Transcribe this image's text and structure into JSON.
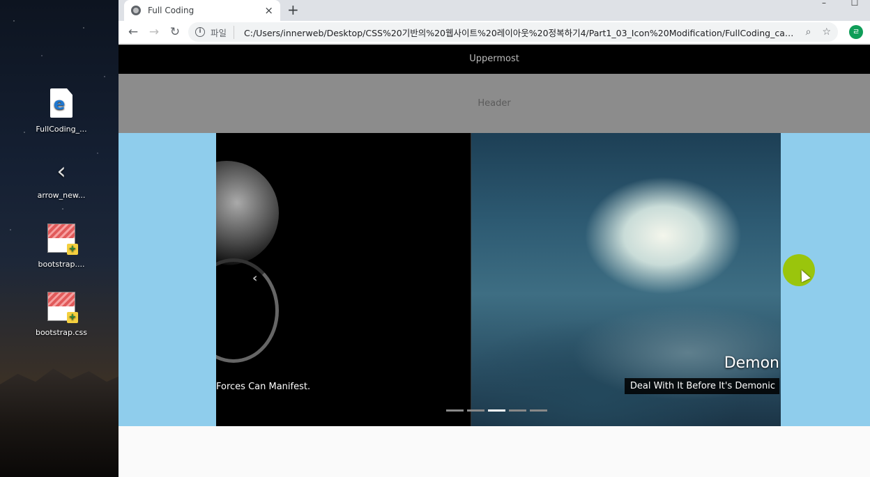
{
  "desktop": {
    "icons": [
      {
        "label": "FullCoding_...",
        "icon": "edge-html-file-icon"
      },
      {
        "label": "arrow_new...",
        "icon": "arrow-image-icon"
      },
      {
        "label": "bootstrap....",
        "icon": "notepad-file-icon"
      },
      {
        "label": "bootstrap.css",
        "icon": "notepad-file-icon"
      }
    ]
  },
  "browser": {
    "tab_title": "Full Coding",
    "tab_close": "×",
    "new_tab": "+",
    "back": "←",
    "forward": "→",
    "reload": "↻",
    "scheme_label": "파일",
    "url": "C:/Users/innerweb/Desktop/CSS%20기반의%20웹사이트%20레이아웃%20정복하기4/Part1_03_Icon%20Modification/FullCoding_car...",
    "profile_initial": "ㄹ"
  },
  "page": {
    "uppermost": "Uppermost",
    "header": "Header",
    "carousel": {
      "prev_caption_fragment": "Forces Can Manifest.",
      "prev_arrow": "‹",
      "active_title": "Demon",
      "active_subtitle": "Deal With It Before It's Demonic",
      "indicator_count": 5,
      "active_indicator": 3
    }
  },
  "colors": {
    "uppermost_bg": "#000000",
    "header_bg": "#8c8c8c",
    "carousel_bg": "#8fcdec",
    "cursor_highlight": "#9bc400"
  }
}
